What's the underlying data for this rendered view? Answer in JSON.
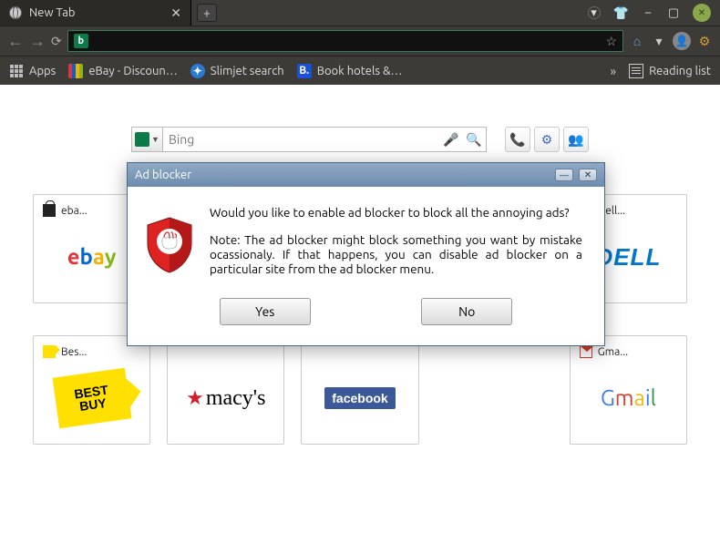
{
  "tab": {
    "title": "New Tab"
  },
  "titlebar_icons": {
    "dropdown": "⏷",
    "shirt": "👕",
    "min": "–",
    "max": "▢",
    "close": "close"
  },
  "toolbar": {
    "back": "←",
    "forward": "→",
    "reload": "⟳",
    "bing": "b",
    "star": "☆",
    "home": "⌂",
    "dropdown": "▾",
    "avatar": "👤",
    "gear": "⚙"
  },
  "bookmarks": {
    "apps": "Apps",
    "ebay": "eBay - Discoun…",
    "slimjet": "Slimjet search",
    "book": "Book hotels &…",
    "reading": "Reading list",
    "more": "»"
  },
  "search": {
    "engine": "b",
    "placeholder": "Bing",
    "mic": "🎤",
    "mag": "🔍"
  },
  "sideicons": {
    "a": "📞",
    "b": "⚙",
    "c": "👥"
  },
  "tiles": [
    {
      "label": "eba...",
      "brand": "ebay"
    },
    {
      "label": "",
      "brand": ""
    },
    {
      "label": "",
      "brand": ""
    },
    {
      "label": "",
      "brand": ""
    },
    {
      "label": "Dell...",
      "brand": "dell"
    },
    {
      "label": "Bes...",
      "brand": "bestbuy"
    },
    {
      "label": "",
      "brand": "macys"
    },
    {
      "label": "",
      "brand": "facebook"
    },
    {
      "label": "",
      "brand": ""
    },
    {
      "label": "Gma...",
      "brand": "gmail"
    }
  ],
  "brand_text": {
    "macys": "macy's",
    "facebook": "facebook",
    "dell": "DELL",
    "bestbuy": "BEST\nBUY",
    "gmail": [
      "G",
      "m",
      "a",
      "i",
      "l"
    ],
    "ebay": [
      "e",
      "b",
      "a",
      "y"
    ]
  },
  "dialog": {
    "title": "Ad blocker",
    "question": "Would you like to enable ad blocker to block all the annoying ads?",
    "note": "Note: The ad blocker might block something you want by mistake ocassionaly. If that happens, you can disable ad blocker on a particular site from the ad blocker menu.",
    "yes": "Yes",
    "no": "No",
    "min": "—",
    "close": "✕"
  }
}
